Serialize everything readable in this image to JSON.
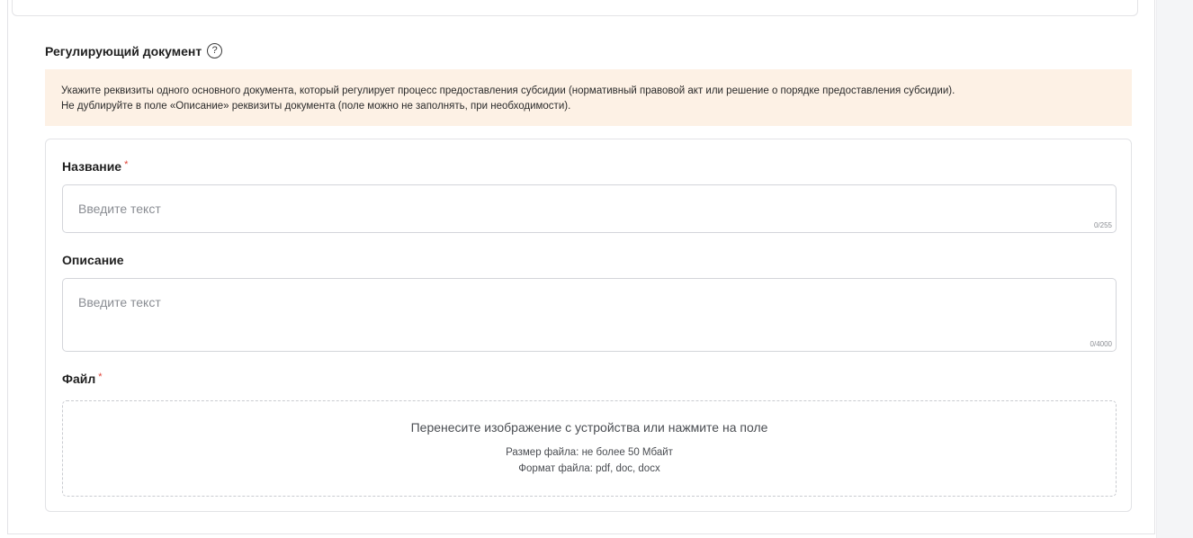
{
  "section": {
    "title": "Регулирующий документ",
    "help_icon": "?"
  },
  "notice": {
    "line1": "Укажите реквизиты одного основного документа, который регулирует процесс предоставления субсидии (нормативный правовой акт или решение о порядке предоставления субсидии).",
    "line2": "Не дублируйте в поле «Описание» реквизиты документа (поле можно не заполнять, при необходимости)."
  },
  "fields": {
    "name": {
      "label": "Название",
      "required_mark": "*",
      "value": "",
      "placeholder": "Введите текст",
      "counter": "0/255"
    },
    "description": {
      "label": "Описание",
      "value": "",
      "placeholder": "Введите текст",
      "counter": "0/4000"
    },
    "file": {
      "label": "Файл",
      "required_mark": "*",
      "dropzone_text": "Перенесите изображение с устройства или нажмите на поле",
      "size_hint": "Размер файла: не более 50 Мбайт",
      "format_hint": "Формат файла: pdf, doc, docx"
    }
  },
  "colors": {
    "notice_bg": "#fdf1e5",
    "required": "#e0453a",
    "border": "#d3d5da"
  }
}
